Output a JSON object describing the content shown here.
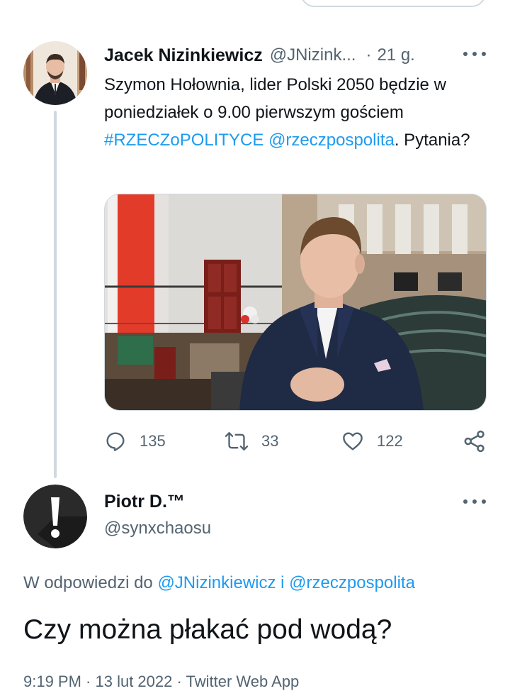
{
  "tweet": {
    "author_name": "Jacek Nizinkiewicz",
    "author_handle": "@JNizink...",
    "separator": "·",
    "time": "21 g.",
    "text_part1": "Szymon Hołownia, lider Polski 2050 będzie w poniedziałek o 9.00 pierwszym gościem ",
    "hashtag": "#RZECZoPOLITYCE",
    "mention": "@rzeczpospolita",
    "text_part2": ". Pytania?",
    "image_description": "photo",
    "replies": "135",
    "retweets": "33",
    "likes": "122"
  },
  "reply": {
    "author_name": "Piotr D.™",
    "author_handle": "@synxchaosu",
    "reply_to_prefix": "W odpowiedzi do ",
    "reply_to_user1": "@JNizinkiewicz",
    "reply_to_and": " i ",
    "reply_to_user2": "@rzeczpospolita",
    "text": "Czy można płakać pod wodą?",
    "meta_partial": "9:19 PM · 13 lut 2022 · Twitter Web App"
  },
  "colors": {
    "accent": "#1d9bf0",
    "text": "#0f1419",
    "muted": "#536471",
    "border": "#cfd9de"
  }
}
